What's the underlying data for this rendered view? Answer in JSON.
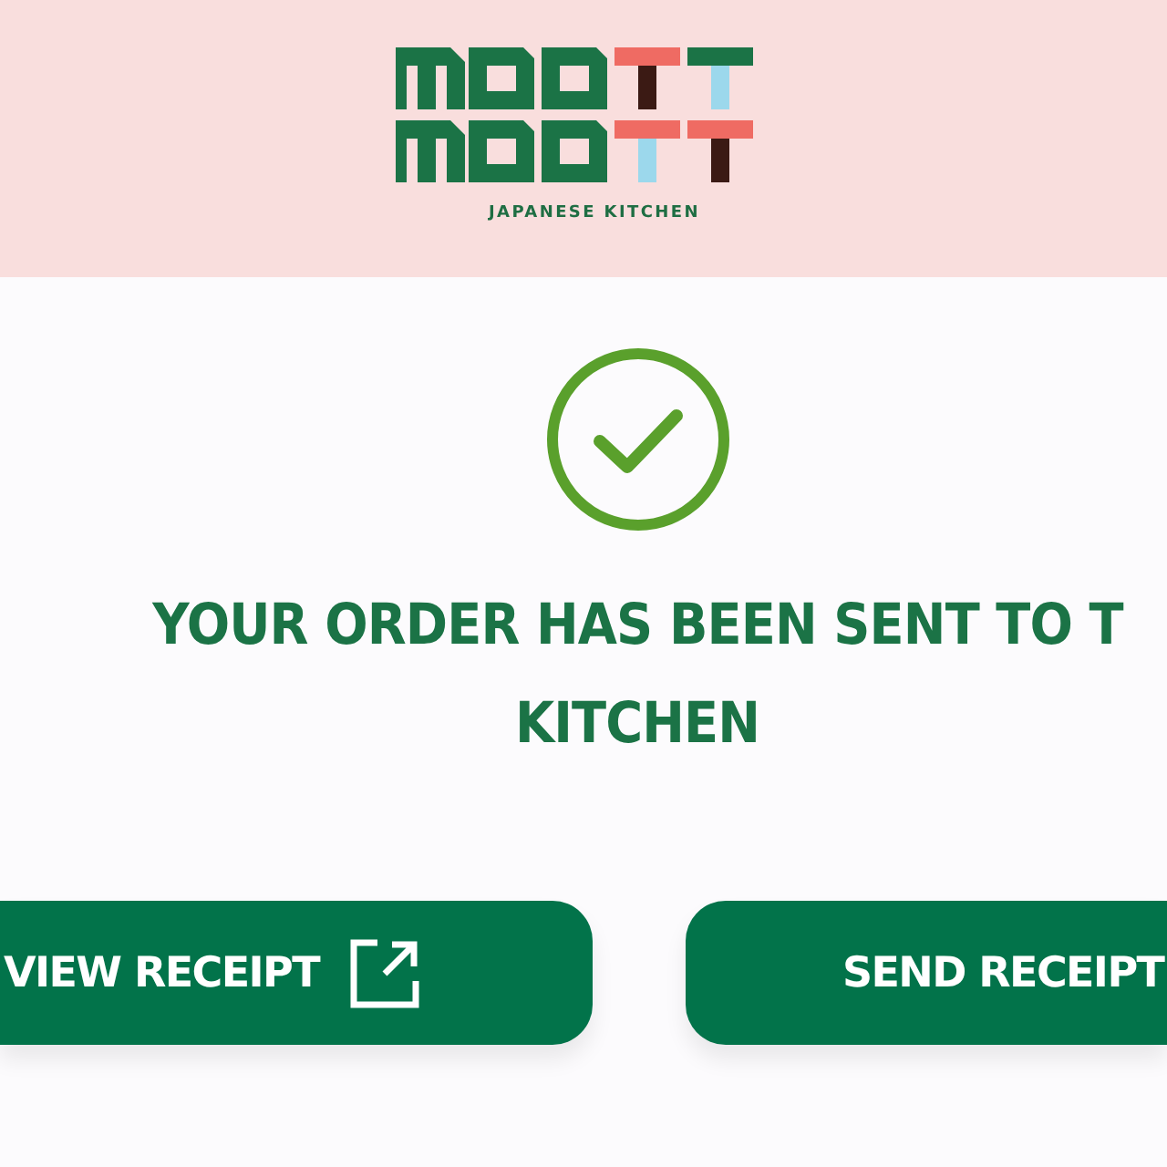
{
  "header": {
    "tagline": "JAPANESE KITCHEN"
  },
  "confirmation": {
    "lines": [
      "YOUR ORDER HAS BEEN SENT TO T",
      "KITCHEN"
    ]
  },
  "buttons": [
    {
      "label": "VIEW RECEIPT",
      "kind": "external"
    },
    {
      "label": "SEND RECEIPT",
      "kind": "plain"
    }
  ]
}
